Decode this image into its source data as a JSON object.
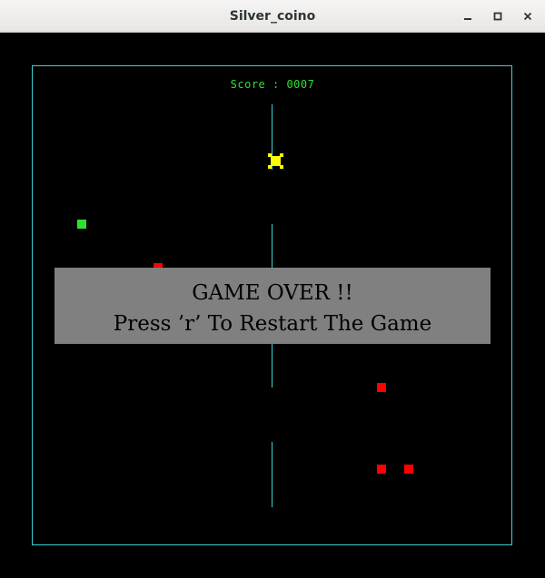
{
  "window": {
    "title": "Silver_coino",
    "buttons": {
      "minimize_icon": "minimize-icon",
      "maximize_icon": "maximize-icon",
      "close_icon": "close-icon"
    }
  },
  "game": {
    "score_text": "Score : 0007",
    "colors": {
      "background": "#000000",
      "border": "#3fd0d0",
      "score": "#2fe02f",
      "player": "#2fe02f",
      "enemy": "#ff0000",
      "coin": "#ffff00",
      "overlay": "#808080"
    },
    "overlay": {
      "line1": "GAME OVER !!",
      "line2": "Press ’r’ To Restart The Game"
    }
  }
}
